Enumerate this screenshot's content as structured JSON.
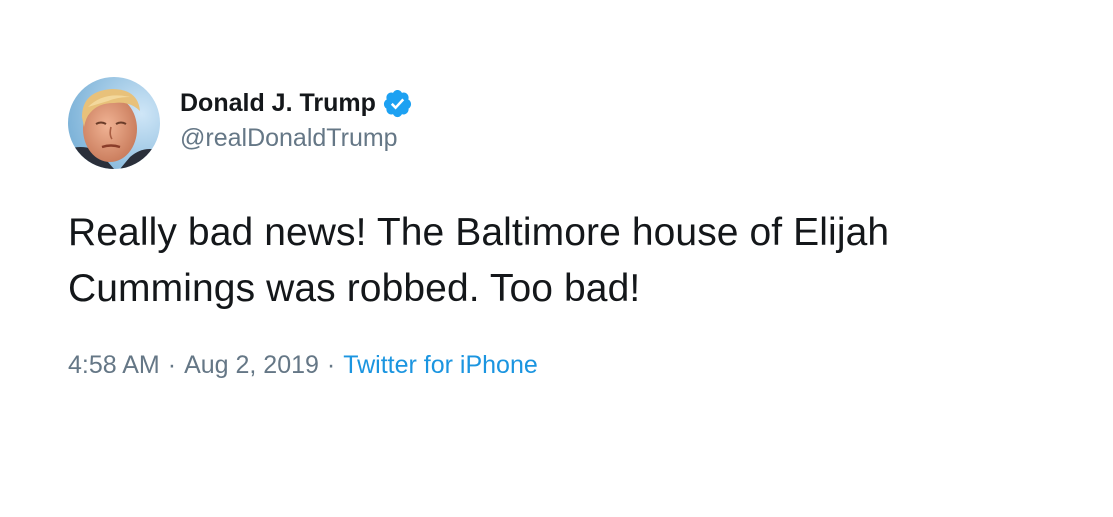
{
  "author": {
    "display_name": "Donald J. Trump",
    "handle": "@realDonaldTrump",
    "verified": true
  },
  "tweet": {
    "text": "Really bad news! The Baltimore house of Elijah\nCummings was robbed. Too bad!"
  },
  "meta": {
    "time": "4:58 AM",
    "separator": "·",
    "date": "Aug 2, 2019",
    "source": "Twitter for iPhone"
  },
  "colors": {
    "text": "#14171a",
    "secondary": "#657786",
    "link": "#1b95e0",
    "verified_badge": "#1da1f2"
  },
  "icons": {
    "verified": "verified-badge-icon",
    "avatar": "profile-photo"
  }
}
